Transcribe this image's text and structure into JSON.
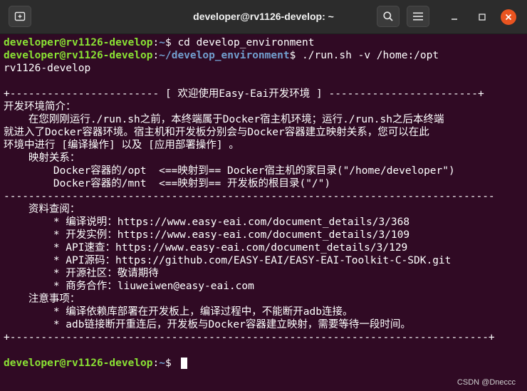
{
  "window": {
    "title": "developer@rv1126-develop: ~",
    "colors": {
      "background": "#300a24",
      "user": "#8ae234",
      "path": "#729fcf",
      "close": "#e95420"
    }
  },
  "titlebar": {
    "new_tab_icon": "new-tab-icon",
    "search_icon": "search-icon",
    "menu_icon": "hamburger-menu-icon",
    "minimize_icon": "minimize-icon",
    "maximize_icon": "maximize-icon",
    "close_icon": "close-icon"
  },
  "terminal": {
    "lines": [
      {
        "user": "developer@rv1126-develop",
        "path": "~",
        "cmd": "$ cd develop_environment"
      },
      {
        "user": "developer@rv1126-develop",
        "path": "~/develop_environment",
        "cmd": "$ ./run.sh -v /home:/opt"
      },
      {
        "text": "rv1126-develop"
      },
      {
        "text": ""
      },
      {
        "text": "+------------------------ [ 欢迎使用Easy-Eai开发环境 ] ------------------------+"
      },
      {
        "text": "开发环境简介："
      },
      {
        "text": "    在您刚刚运行./run.sh之前，本终端属于Docker宿主机环境；运行./run.sh之后本终端"
      },
      {
        "text": "就进入了Docker容器环境。宿主机和开发板分别会与Docker容器建立映射关系，您可以在此"
      },
      {
        "text": "环境中进行 [编译操作] 以及 [应用部署操作] 。"
      },
      {
        "text": "    映射关系："
      },
      {
        "text": "        Docker容器的/opt  <==映射到== Docker宿主机的家目录(\"/home/developer\")"
      },
      {
        "text": "        Docker容器的/mnt  <==映射到== 开发板的根目录(\"/\")"
      },
      {
        "text": "-------------------------------------------------------------------------------"
      },
      {
        "text": "    资料查阅："
      },
      {
        "text": "        * 编译说明：https://www.easy-eai.com/document_details/3/368"
      },
      {
        "text": "        * 开发实例：https://www.easy-eai.com/document_details/3/109"
      },
      {
        "text": "        * API速查：https://www.easy-eai.com/document_details/3/129"
      },
      {
        "text": "        * API源码：https://github.com/EASY-EAI/EASY-EAI-Toolkit-C-SDK.git"
      },
      {
        "text": "        * 开源社区：敬请期待"
      },
      {
        "text": "        * 商务合作：liuweiwen@easy-eai.com"
      },
      {
        "text": "    注意事项："
      },
      {
        "text": "        * 编译依赖库部署在开发板上，编译过程中，不能断开adb连接。"
      },
      {
        "text": "        * adb链接断开重连后，开发板与Docker容器建立映射，需要等待一段时间。"
      },
      {
        "text": "+-----------------------------------------------------------------------------+"
      },
      {
        "text": ""
      },
      {
        "user": "developer@rv1126-develop",
        "path": "~",
        "cmd": "$ "
      }
    ]
  },
  "watermark": "CSDN @Dneccc"
}
